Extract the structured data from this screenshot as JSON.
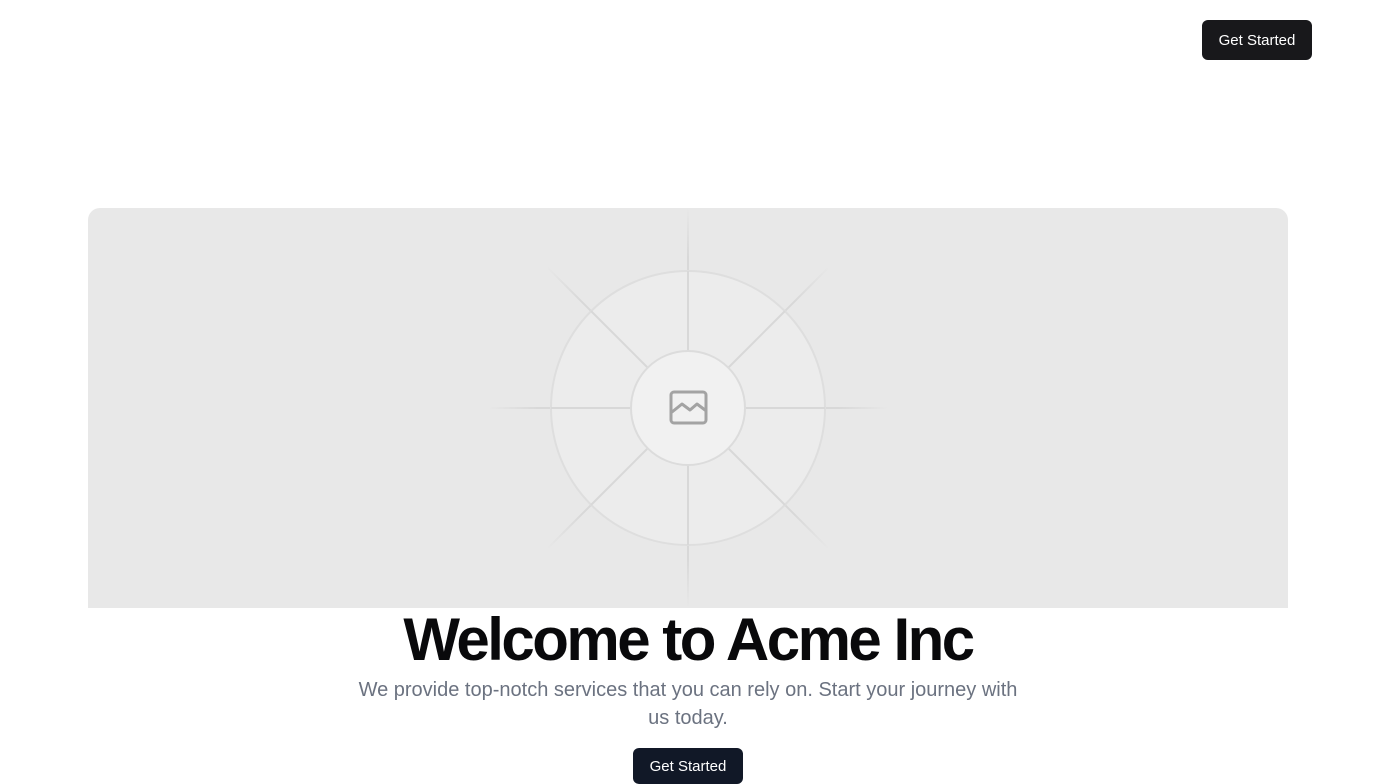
{
  "header": {
    "cta_label": "Get Started"
  },
  "hero": {
    "image_icon": "image-placeholder-icon",
    "title": "Welcome to Acme Inc",
    "subtitle": "We provide top-notch services that you can rely on. Start your journey with us today.",
    "cta_label": "Get Started"
  },
  "colors": {
    "button_bg": "#18181b",
    "hero_button_bg": "#111827",
    "placeholder_bg": "#e8e8e8",
    "subtitle_text": "#6b7280",
    "title_text": "#09090b"
  }
}
